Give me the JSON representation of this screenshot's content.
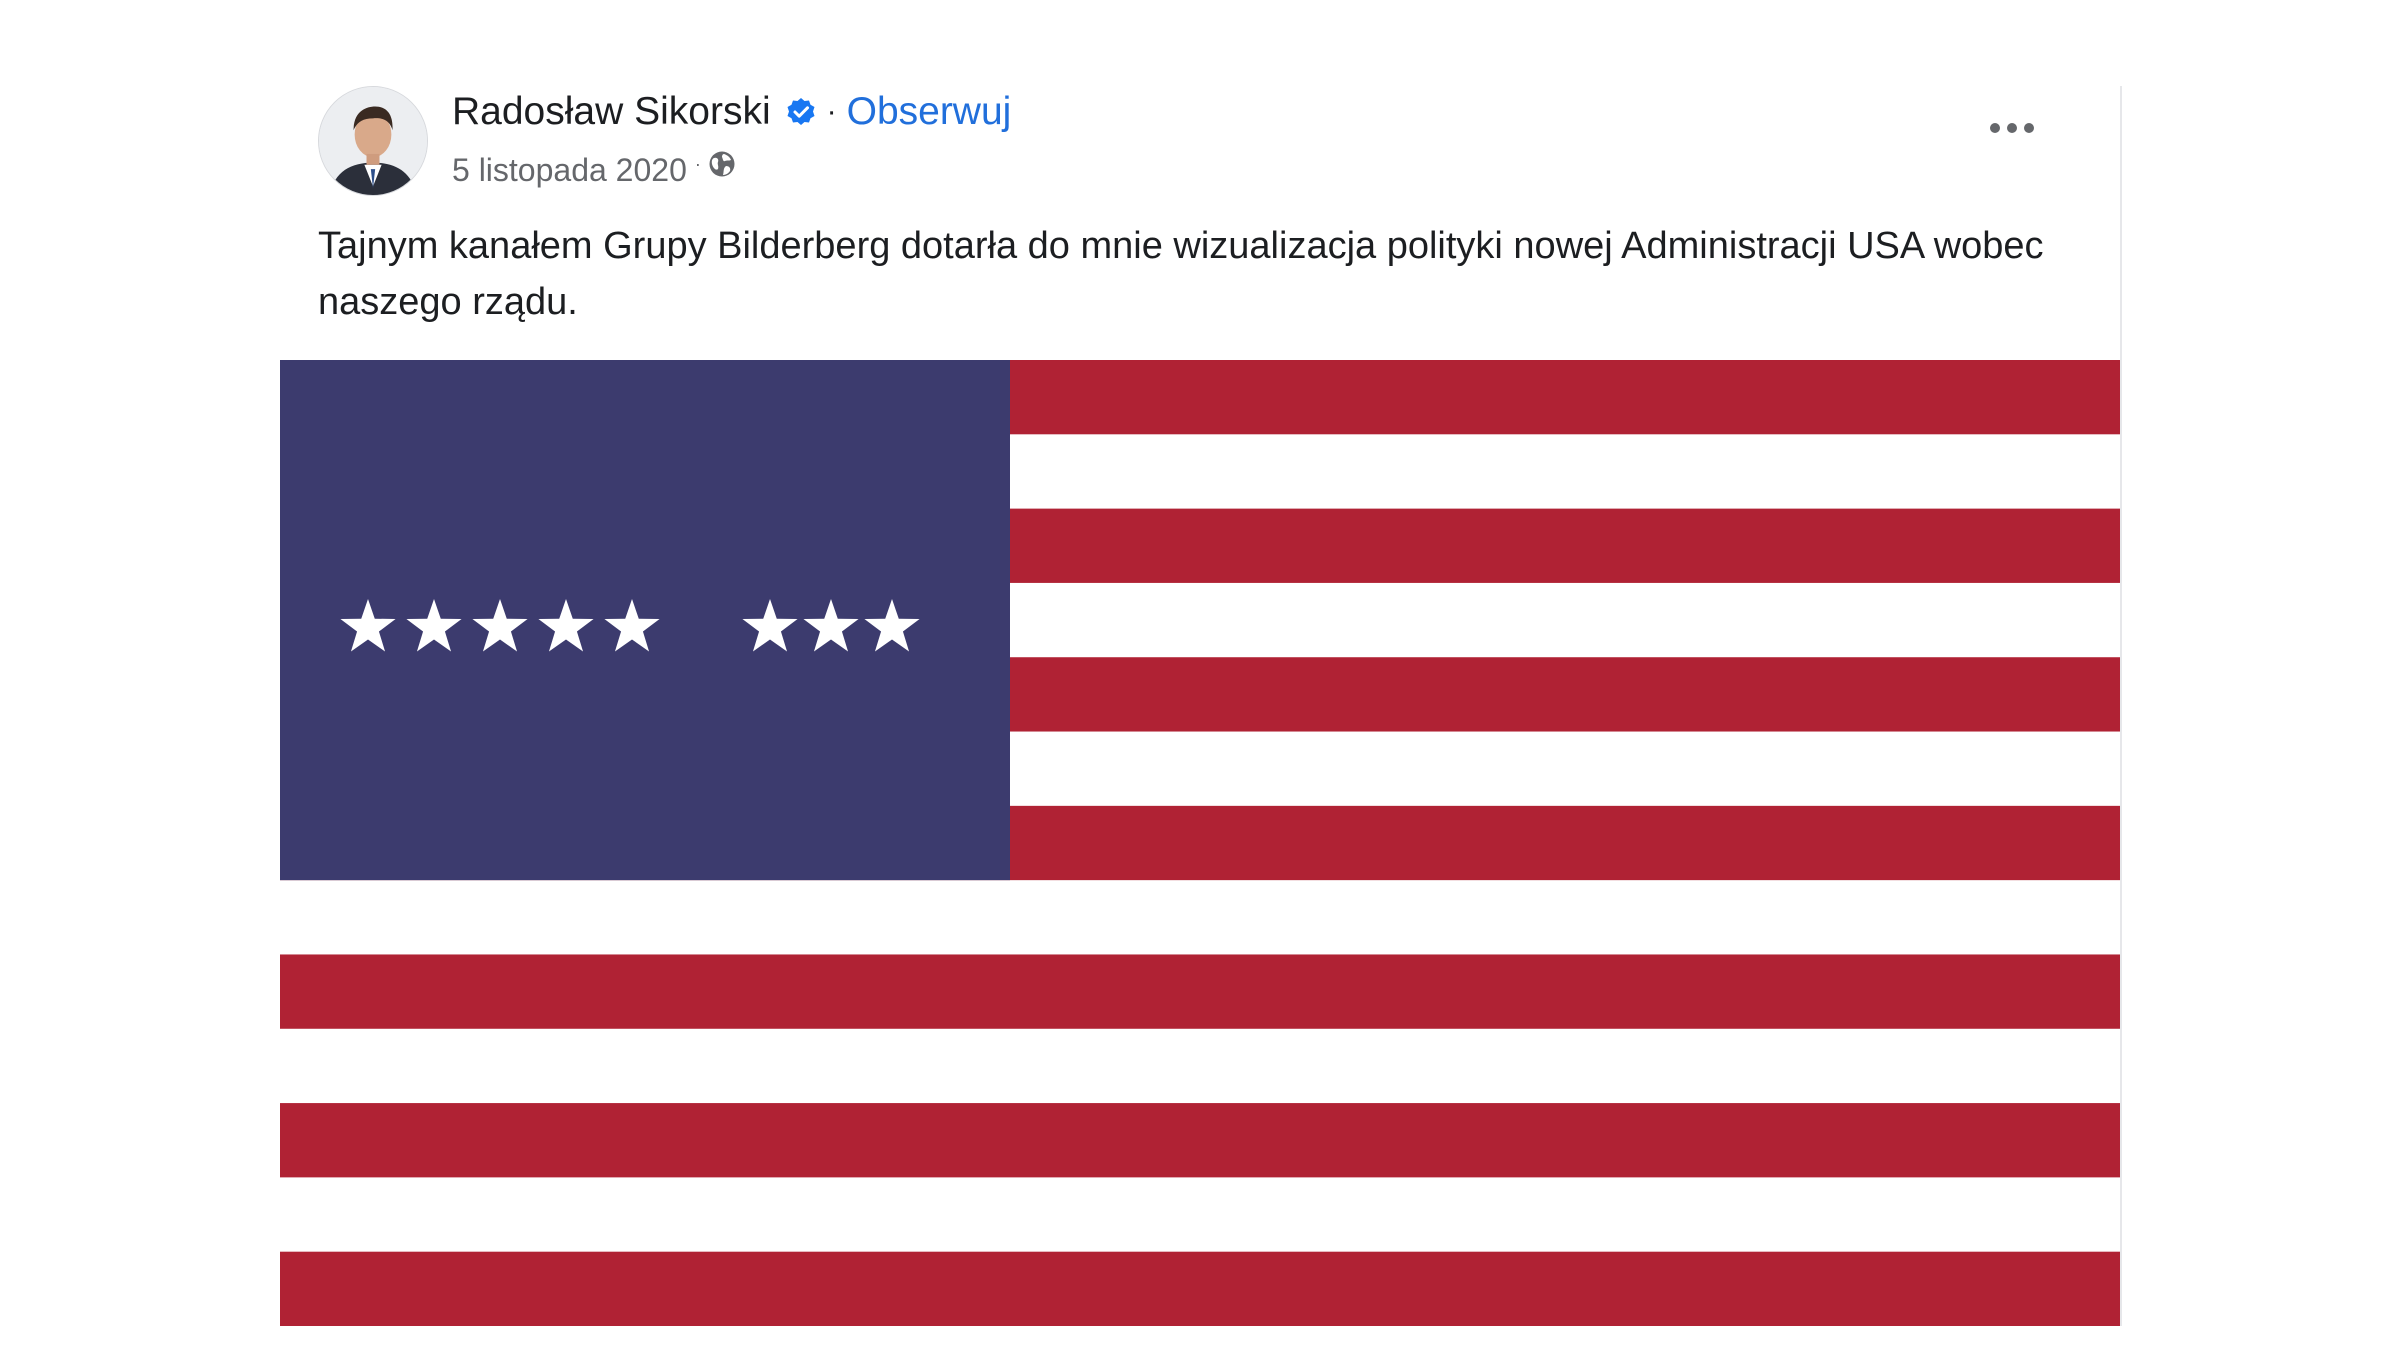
{
  "post": {
    "author": "Radosław Sikorski",
    "follow_label": "Obserwuj",
    "separator": "·",
    "date": "5 listopada 2020",
    "meta_separator": "·",
    "text": "Tajnym kanałem Grupy Bilderberg dotarła do mnie wizualizacja polityki nowej Administracji USA wobec naszego rządu.",
    "icons": {
      "verified": "verified-badge-icon",
      "audience": "globe-icon",
      "more": "more-options-icon"
    }
  },
  "image": {
    "description": "flag",
    "stripe_count": 13,
    "canton_stars_left_group": 5,
    "canton_stars_right_group": 3,
    "colors": {
      "red": "#b02234",
      "white": "#ffffff",
      "blue": "#3c3b6e",
      "star": "#ffffff"
    }
  },
  "colors": {
    "link": "#216fdb",
    "text": "#1c1e21",
    "muted": "#65676b",
    "verified": "#1877f2"
  }
}
